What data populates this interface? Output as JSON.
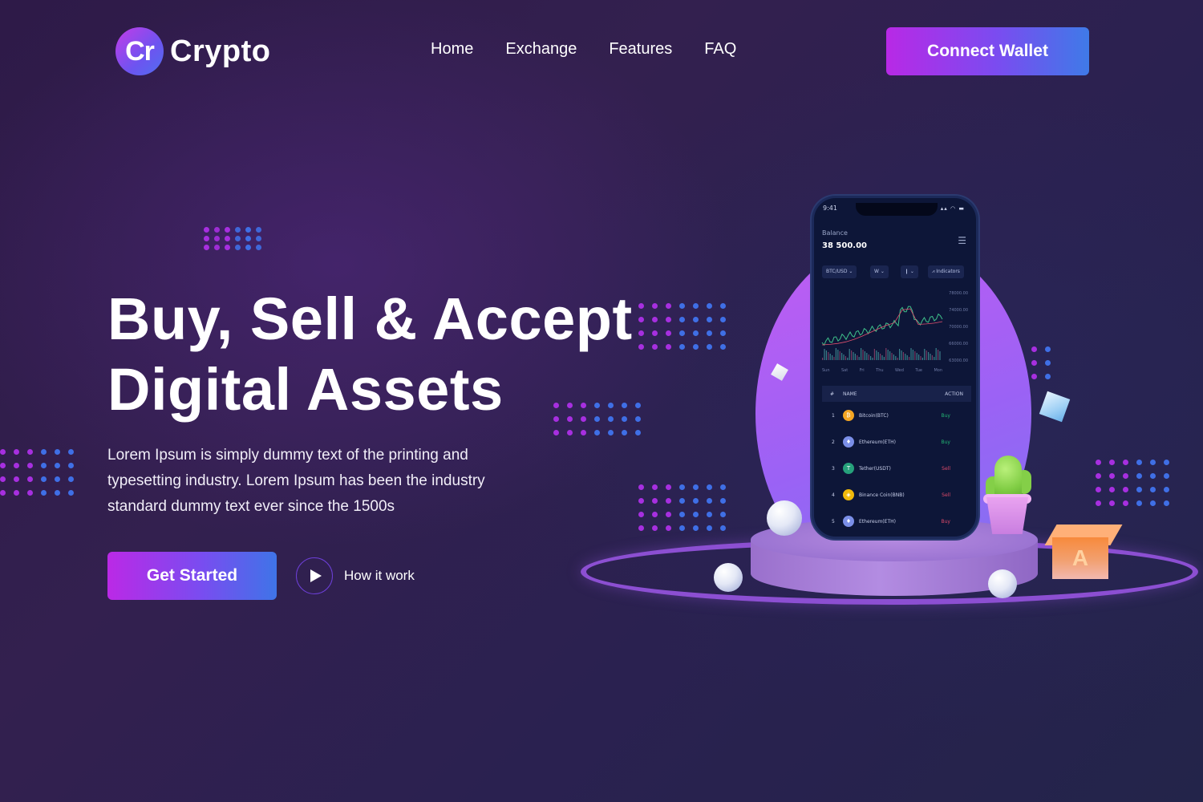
{
  "brand": {
    "mark": "Cr",
    "name": "Crypto"
  },
  "nav": {
    "items": [
      {
        "label": "Home"
      },
      {
        "label": "Exchange"
      },
      {
        "label": "Features"
      },
      {
        "label": "FAQ"
      }
    ],
    "connect_label": "Connect Wallet"
  },
  "hero": {
    "headline_line1": "Buy, Sell & Accept",
    "headline_line2": "Digital Assets",
    "description": "Lorem Ipsum is simply dummy text of the printing and typesetting industry. Lorem Ipsum has been the industry standard dummy text ever since the 1500s",
    "cta_label": "Get Started",
    "video_label": "How it work",
    "play_icon": "play-icon"
  },
  "colors": {
    "accent_start": "#b829e6",
    "accent_end": "#3f7ae8",
    "background": "#2e1a48",
    "dot_purple": "#a72fe0",
    "dot_blue": "#3f6fe6"
  },
  "phone": {
    "time": "9:41",
    "balance_label": "Balance",
    "balance_value": "38 500.00",
    "chips": {
      "pair": "BTC/USD ⌄",
      "interval": "W ⌄",
      "type": "❙ ⌄",
      "indicators": "⩘ Indicators"
    },
    "y_ticks": [
      "78000.00",
      "74000.00",
      "70000.00",
      "66000.00",
      "63000.00"
    ],
    "x_ticks": [
      "Sun",
      "Sat",
      "Fri",
      "Thu",
      "Wed",
      "Tue",
      "Mon"
    ],
    "table": {
      "headers": {
        "num": "#",
        "name": "NAME",
        "action": "ACTION"
      },
      "rows": [
        {
          "num": "1",
          "name": "Bitcoin(BTC)",
          "action": "Buy",
          "icon": "₿",
          "icon_color": "#f5a623",
          "action_color": "#22b573"
        },
        {
          "num": "2",
          "name": "Ethereum(ETH)",
          "action": "Buy",
          "icon": "♦",
          "icon_color": "#7b8fe8",
          "action_color": "#22b573"
        },
        {
          "num": "3",
          "name": "Tether(USDT)",
          "action": "Sell",
          "icon": "T",
          "icon_color": "#26a17b",
          "action_color": "#e04a6a"
        },
        {
          "num": "4",
          "name": "Binance Coin(BNB)",
          "action": "Sell",
          "icon": "◈",
          "icon_color": "#f0b90b",
          "action_color": "#e04a6a"
        },
        {
          "num": "5",
          "name": "Ethereum(ETH)",
          "action": "Buy",
          "icon": "♦",
          "icon_color": "#7b8fe8",
          "action_color": "#e04a6a"
        }
      ]
    }
  }
}
